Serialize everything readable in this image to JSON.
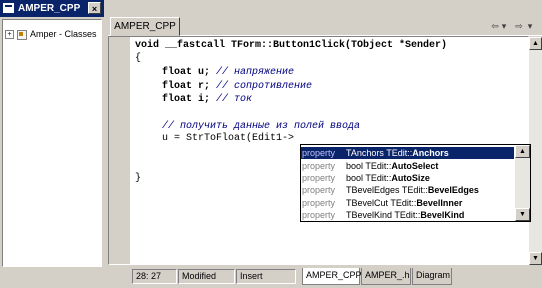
{
  "window": {
    "title": "AMPER_CPP"
  },
  "class_tree": {
    "item_label": "Amper - Classes",
    "expander": "+"
  },
  "editor_tab": {
    "label": "AMPER_CPP"
  },
  "nav": {
    "back": "⇦",
    "back_drop": "▾",
    "fwd": "⇨",
    "fwd_drop": "▾"
  },
  "code": {
    "line1": "void __fastcall TForm::Button1Click(TObject *Sender)",
    "line2": "{",
    "line3_code": "float u;",
    "line3_comment": "// напряжение",
    "line4_code": "float r;",
    "line4_comment": "// сопротивление",
    "line5_code": "float i;",
    "line5_comment": "// ток",
    "line6_comment": "// получить данные из полей ввода",
    "line7": "u = StrToFloat(Edit1->",
    "line8": "}"
  },
  "completion": {
    "items": [
      {
        "kind": "property",
        "type": "TAnchors",
        "owner": "TEdit::",
        "name": "Anchors"
      },
      {
        "kind": "property",
        "type": "bool",
        "owner": "TEdit::",
        "name": "AutoSelect"
      },
      {
        "kind": "property",
        "type": "bool",
        "owner": "TEdit::",
        "name": "AutoSize"
      },
      {
        "kind": "property",
        "type": "TBevelEdges",
        "owner": "TEdit::",
        "name": "BevelEdges"
      },
      {
        "kind": "property",
        "type": "TBevelCut",
        "owner": "TEdit::",
        "name": "BevelInner"
      },
      {
        "kind": "property",
        "type": "TBevelKind",
        "owner": "TEdit::",
        "name": "BevelKind"
      }
    ],
    "selected_index": 0
  },
  "status": {
    "position": "28: 27",
    "modified": "Modified",
    "mode": "Insert",
    "tabs": [
      "AMPER_CPP",
      "AMPER_.h",
      "Diagram"
    ]
  },
  "colors": {
    "title_bar": "#0a246a",
    "selection": "#0a246a",
    "comment": "#000080"
  }
}
